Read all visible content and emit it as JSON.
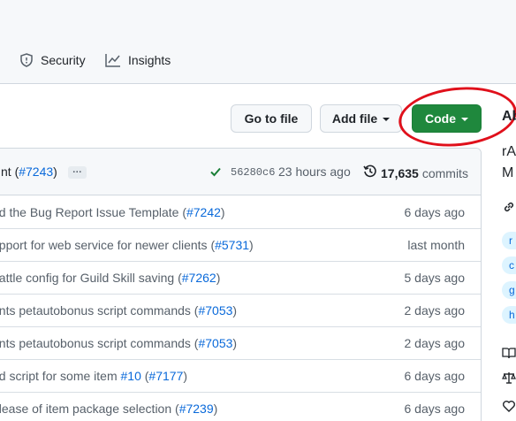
{
  "nav": {
    "tabs": [
      {
        "label": "Security",
        "icon": "shield-icon"
      },
      {
        "label": "Insights",
        "icon": "graph-icon"
      }
    ]
  },
  "toolbar": {
    "go_to_file": "Go to file",
    "add_file": "Add file",
    "code": "Code"
  },
  "latest_commit": {
    "message_prefix": "nt (",
    "pr_link": "#7243",
    "message_suffix": ")",
    "ellipsis": "…",
    "sha": "56280c6",
    "age": "23 hours ago",
    "commit_count": "17,635",
    "commits_label": "commits"
  },
  "files": [
    {
      "text": "ed the Bug Report Issue Template (",
      "link": "#7242",
      "after": ")",
      "when": "6 days ago"
    },
    {
      "text": "upport for web service for newer clients (",
      "link": "#5731",
      "after": ")",
      "when": "last month"
    },
    {
      "text": "battle config for Guild Skill saving (",
      "link": "#7262",
      "after": ")",
      "when": "5 days ago"
    },
    {
      "text": "ents petautobonus script commands (",
      "link": "#7053",
      "after": ")",
      "when": "2 days ago"
    },
    {
      "text": "ents petautobonus script commands (",
      "link": "#7053",
      "after": ")",
      "when": "2 days ago"
    },
    {
      "text": "ed script for some item ",
      "link": "#10",
      "link2": "#7177",
      "after": ")",
      "when": "6 days ago"
    },
    {
      "text": "elease of item package selection (",
      "link": "#7239",
      "after": ")",
      "when": "6 days ago"
    }
  ],
  "sidebar": {
    "heading": "Ab",
    "desc_line1": "rA",
    "desc_line2": "M",
    "topics": [
      "r",
      "c",
      "g",
      "h"
    ]
  },
  "colors": {
    "code_button": "#1f883d",
    "annotation": "#e0101b",
    "link": "#0969da"
  }
}
